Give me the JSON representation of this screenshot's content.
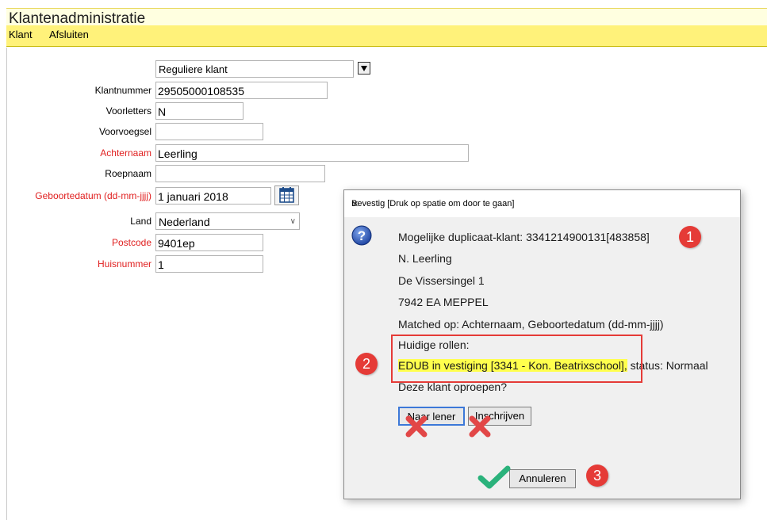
{
  "app": {
    "title": "Klantenadministratie",
    "menu": [
      "Klant",
      "Afsluiten"
    ]
  },
  "form": {
    "client_type": "Reguliere klant",
    "fields": [
      {
        "label": "Klantnummer",
        "value": "29505000108535",
        "required": false
      },
      {
        "label": "Voorletters",
        "value": "N",
        "required": false
      },
      {
        "label": "Voorvoegsel",
        "value": "",
        "required": false
      },
      {
        "label": "Achternaam",
        "value": "Leerling",
        "required": true
      },
      {
        "label": "Roepnaam",
        "value": "",
        "required": false
      },
      {
        "label": "Geboortedatum (dd-mm-jjjj)",
        "value": "1 januari 2018",
        "required": true
      },
      {
        "label": "Land",
        "value": "Nederland",
        "required": false
      },
      {
        "label": "Postcode",
        "value": "9401ep",
        "required": true
      },
      {
        "label": "Huisnummer",
        "value": "1",
        "required": true
      }
    ]
  },
  "dialog": {
    "title": "Bevestig [Druk op spatie om door te gaan]",
    "icon": "question-icon",
    "lines": [
      "Mogelijke duplicaat-klant: 3341214900131[483858]",
      "N. Leerling",
      "De Vissersingel 1",
      "7942 EA MEPPEL",
      "Matched op: Achternaam, Geboortedatum (dd-mm-jjjj)",
      "Huidige rollen:"
    ],
    "role_highlight": "EDUB in vestiging [3341 - Kon. Beatrixschool],",
    "role_rest": " status: Normaal",
    "question": "Deze klant oproepen?",
    "buttons": {
      "naar_lener": "Naar lener",
      "inschrijven": "Inschrijven",
      "annuleren": "Annuleren"
    }
  },
  "annotations": {
    "badges": [
      "1",
      "2",
      "3"
    ],
    "badge_color": "#e53b37",
    "highlight_color": "#ffff4d",
    "check_color": "#2ab27b"
  }
}
